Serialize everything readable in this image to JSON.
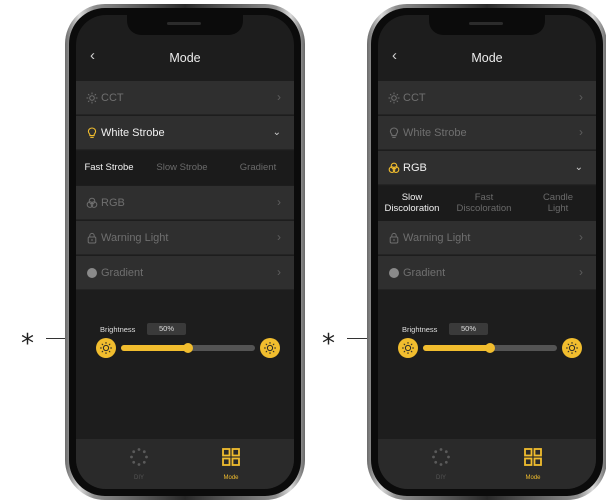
{
  "colors": {
    "accent": "#f1bd2e",
    "screen_bg": "#1d1d1d",
    "row_bg": "#2f2f2f"
  },
  "annotation": {
    "marker": "*"
  },
  "screens": [
    {
      "header": {
        "back_icon": "chevron-left-icon",
        "title": "Mode"
      },
      "menu": [
        {
          "icon": "sun-icon",
          "label": "CCT",
          "state": "inactive"
        },
        {
          "icon": "bulb-icon",
          "label": "White Strobe",
          "state": "expanded"
        },
        {
          "icon": "rgb-circles-icon",
          "label": "RGB",
          "state": "inactive"
        },
        {
          "icon": "lock-icon",
          "label": "Warning Light",
          "state": "inactive"
        },
        {
          "icon": "dot-icon",
          "label": "Gradient",
          "state": "inactive"
        }
      ],
      "submenu": [
        {
          "label": "Fast Strobe",
          "selected": true
        },
        {
          "label": "Slow Strobe",
          "selected": false
        },
        {
          "label": "Gradient",
          "selected": false
        }
      ],
      "brightness": {
        "label": "Brightness",
        "value": "50%",
        "level": 0.5
      },
      "tabbar": [
        {
          "icon": "dots-circle-icon",
          "label": "DIY",
          "active": false
        },
        {
          "icon": "grid-icon",
          "label": "Mode",
          "active": true
        }
      ]
    },
    {
      "header": {
        "back_icon": "chevron-left-icon",
        "title": "Mode"
      },
      "menu": [
        {
          "icon": "sun-icon",
          "label": "CCT",
          "state": "inactive"
        },
        {
          "icon": "bulb-icon",
          "label": "White Strobe",
          "state": "inactive"
        },
        {
          "icon": "rgb-circles-icon",
          "label": "RGB",
          "state": "expanded"
        },
        {
          "icon": "lock-icon",
          "label": "Warning Light",
          "state": "inactive"
        },
        {
          "icon": "dot-icon",
          "label": "Gradient",
          "state": "inactive"
        }
      ],
      "submenu": [
        {
          "label": "Slow Discoloration",
          "selected": true
        },
        {
          "label": "Fast Discoloration",
          "selected": false
        },
        {
          "label": "Candle Light",
          "selected": false
        }
      ],
      "brightness": {
        "label": "Brightness",
        "value": "50%",
        "level": 0.5
      },
      "tabbar": [
        {
          "icon": "dots-circle-icon",
          "label": "DIY",
          "active": false
        },
        {
          "icon": "grid-icon",
          "label": "Mode",
          "active": true
        }
      ]
    }
  ]
}
